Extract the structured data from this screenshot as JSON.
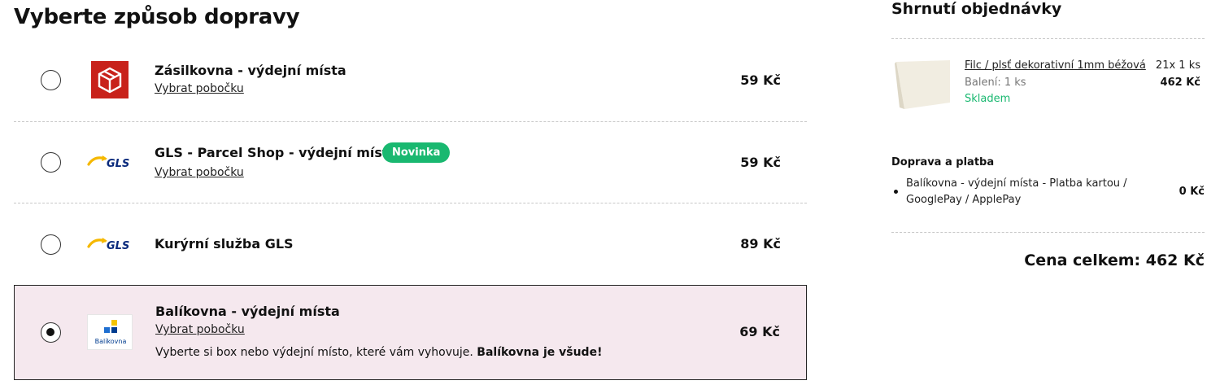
{
  "page_title": "Vyberte způsob dopravy",
  "shipping_options": [
    {
      "name": "Zásilkovna - výdejní místa",
      "link": "Vybrat pobočku",
      "price": "59 Kč",
      "selected": false
    },
    {
      "name": "GLS - Parcel Shop - výdejní místa",
      "badge": "Novinka",
      "link": "Vybrat pobočku",
      "price": "59 Kč",
      "selected": false
    },
    {
      "name": "Kurýrní služba GLS",
      "price": "89 Kč",
      "selected": false
    },
    {
      "name": "Balíkovna - výdejní místa",
      "link": "Vybrat pobočku",
      "price": "69 Kč",
      "description": "Vyberte si box nebo výdejní místo, které vám vyhovuje.",
      "description_bold": "Balíkovna je všude!",
      "selected": true
    }
  ],
  "logos": {
    "gls_text": "GLS",
    "balikovna_text": "Balíkovna"
  },
  "summary": {
    "title": "Shrnutí objednávky",
    "product": {
      "name": "Filc / plsť dekorativní 1mm béžová",
      "pack": "Balení: 1 ks",
      "stock": "Skladem",
      "qty": "21x 1 ks",
      "price": "462 Kč"
    },
    "delivery_payment_title": "Doprava a platba",
    "delivery_payment_item": "Balíkovna - výdejní místa - Platba kartou / GooglePay / ApplePay",
    "delivery_payment_price": "0 Kč",
    "total": "Cena celkem: 462 Kč"
  },
  "colors": {
    "accent_green": "#19b870",
    "selected_bg": "#f5e8ee",
    "zasilkovna_red": "#c8221b",
    "gls_blue": "#0a2a7c",
    "gls_yellow": "#f5b800"
  }
}
